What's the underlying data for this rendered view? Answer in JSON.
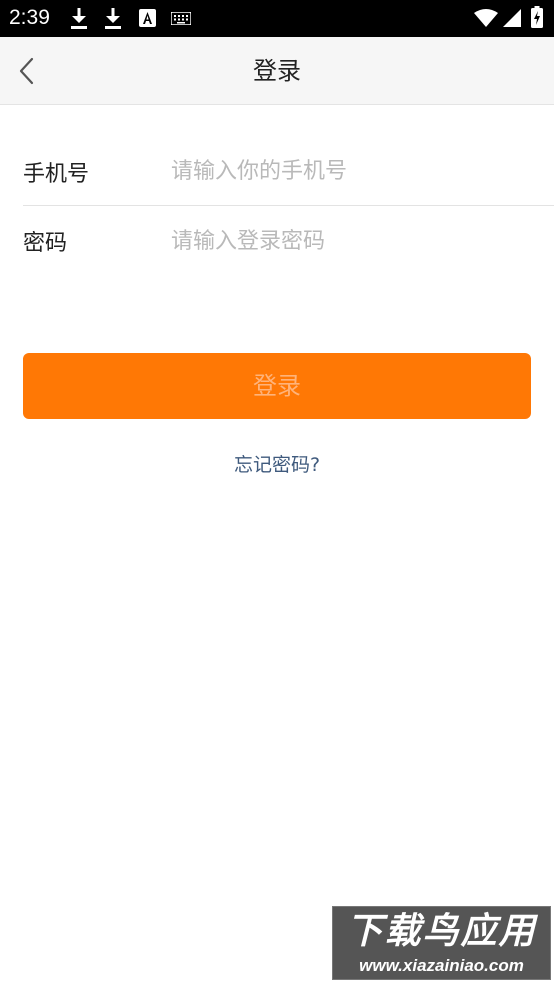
{
  "status_bar": {
    "time": "2:39",
    "icons": [
      "download-icon",
      "download-icon",
      "text-a-icon",
      "keyboard-icon",
      "wifi-icon",
      "cellular-signal-icon",
      "battery-charging-icon"
    ]
  },
  "header": {
    "title": "登录",
    "back_icon": "chevron-left-icon"
  },
  "form": {
    "phone": {
      "label": "手机号",
      "value": "",
      "placeholder": "请输入你的手机号"
    },
    "password": {
      "label": "密码",
      "value": "",
      "placeholder": "请输入登录密码"
    }
  },
  "login_button": {
    "label": "登录"
  },
  "forgot_password": {
    "label": "忘记密码?"
  },
  "watermark": {
    "title": "下载鸟应用",
    "url": "www.xiazainiao.com"
  },
  "colors": {
    "accent": "#ff7805",
    "link": "#3f5a7d",
    "placeholder": "#b9b9b9",
    "status_bar": "#000000"
  }
}
